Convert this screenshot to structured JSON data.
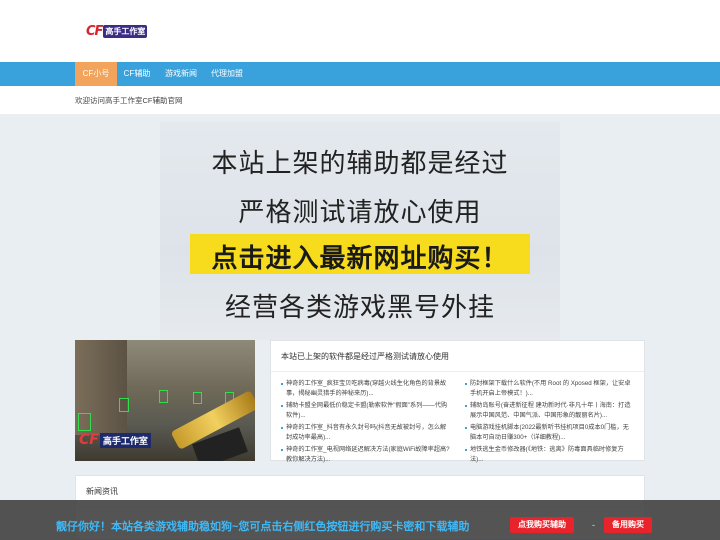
{
  "header": {
    "logo_mark": "CF",
    "logo_text": "高手工作室"
  },
  "nav": {
    "items": [
      {
        "label": "CF小号",
        "active": true
      },
      {
        "label": "CF辅助",
        "active": false
      },
      {
        "label": "游戏新闻",
        "active": false
      },
      {
        "label": "代理加盟",
        "active": false
      }
    ]
  },
  "welcome": "欢迎访问高手工作室CF辅助官网",
  "banner": {
    "line1": "本站上架的辅助都是经过",
    "line2": "严格测试请放心使用",
    "line3": "点击进入最新网址购买！",
    "line4": "经营各类游戏黑号外挂",
    "highlight_color": "#f7dc1e"
  },
  "game_shot": {
    "logo_mark": "CF",
    "logo_text": "高手工作室"
  },
  "news_box": {
    "title": "本站已上架的软件都是经过严格测试请放心使用",
    "left_items": [
      "神奇的工作室_疯狂宝贝吃病毒(穿越火线生化角色的背景故事，揭秘幽灵猎手的神秘来历)...",
      "辅助卡盟全网最低价稳定卡盟(勒索软件\"假面\"系列——代购软件)...",
      "神奇的工作室_抖音有永久封号吗(抖音无故被封号，怎么解封成功率最高)...",
      "神奇的工作室_电视网络延迟解决方法(家庭WiFi故障率超高?教你解决方法)..."
    ],
    "right_items": [
      "防封框架下载什么软件(不用 Root 的 Xposed 框架，让安卓手机开启上帝模式！)...",
      "辅助岛账号(奋进新征程 建功新时代·非凡十年丨海南：打造展示中国风范、中国气派、中国形象的靓丽名片)...",
      "电脑游戏挂机脚本(2022最新听书挂机项目0成本0门槛，无脑本可自动日赚300+（详细教程)...",
      "地铁逃生金币修改器(《地铁：逃离》防毒面具临时修复方法)..."
    ]
  },
  "section": {
    "title": "新闻资讯"
  },
  "promo": {
    "text": "靓仔你好！本站各类游戏辅助稳如狗~您可点击右侧红色按钮进行购买卡密和下载辅助",
    "buy_button": "点我购买辅助",
    "separator": "-",
    "backup_button": "备用购买",
    "text_color": "#3fb8f5",
    "button_color": "#e8232b"
  }
}
